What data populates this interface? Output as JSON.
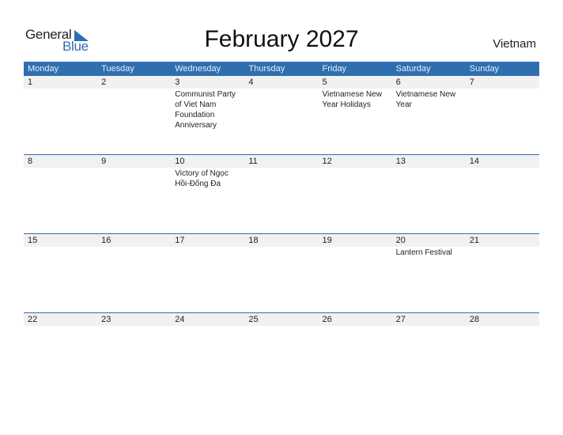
{
  "logo": {
    "general": "General",
    "blue": "Blue"
  },
  "title": "February 2027",
  "country": "Vietnam",
  "weekdays": [
    "Monday",
    "Tuesday",
    "Wednesday",
    "Thursday",
    "Friday",
    "Saturday",
    "Sunday"
  ],
  "weeks": [
    {
      "days": [
        "1",
        "2",
        "3",
        "4",
        "5",
        "6",
        "7"
      ],
      "events": [
        "",
        "",
        "Communist Party of Viet Nam Foundation Anniversary",
        "",
        "Vietnamese New Year Holidays",
        "Vietnamese New Year",
        ""
      ]
    },
    {
      "days": [
        "8",
        "9",
        "10",
        "11",
        "12",
        "13",
        "14"
      ],
      "events": [
        "",
        "",
        "Victory of Ngọc Hồi-Đống Đa",
        "",
        "",
        "",
        ""
      ]
    },
    {
      "days": [
        "15",
        "16",
        "17",
        "18",
        "19",
        "20",
        "21"
      ],
      "events": [
        "",
        "",
        "",
        "",
        "",
        "Lantern Festival",
        ""
      ]
    },
    {
      "days": [
        "22",
        "23",
        "24",
        "25",
        "26",
        "27",
        "28"
      ],
      "events": [
        "",
        "",
        "",
        "",
        "",
        "",
        ""
      ]
    }
  ],
  "colors": {
    "accent": "#2e6faf",
    "day_row_bg": "#f1f1f1"
  }
}
